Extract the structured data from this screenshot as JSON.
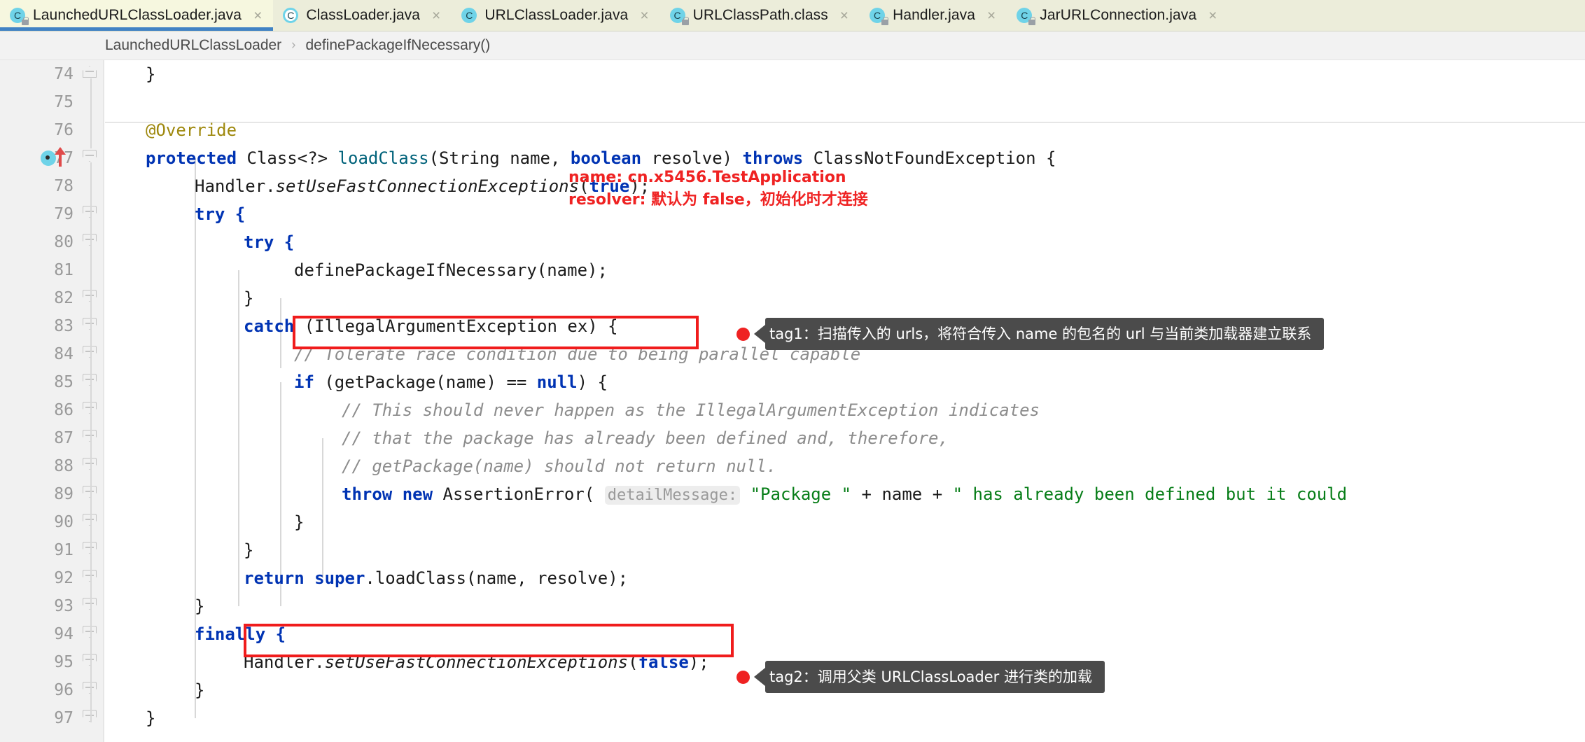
{
  "window": {
    "accent_blue": "#4183c4",
    "annotation_red": "#ef2222",
    "tooltip_gray": "#4b4b4b"
  },
  "tabs": [
    {
      "label": "LaunchedURLClassLoader.java",
      "icon": "java-class-icon",
      "locked": true,
      "active": true,
      "close": "×"
    },
    {
      "label": "ClassLoader.java",
      "icon": "java-class-icon",
      "locked": false,
      "active": false,
      "close": "×"
    },
    {
      "label": "URLClassLoader.java",
      "icon": "java-class-icon",
      "locked": false,
      "active": false,
      "close": "×"
    },
    {
      "label": "URLClassPath.class",
      "icon": "java-class-icon",
      "locked": true,
      "active": false,
      "close": "×"
    },
    {
      "label": "Handler.java",
      "icon": "java-class-icon",
      "locked": true,
      "active": false,
      "close": "×"
    },
    {
      "label": "JarURLConnection.java",
      "icon": "java-class-icon",
      "locked": true,
      "active": false,
      "close": "×"
    }
  ],
  "breadcrumb": {
    "class": "LaunchedURLClassLoader",
    "separator": "›",
    "method": "definePackageIfNecessary()"
  },
  "editor": {
    "first_line": 74,
    "gutter_icon": "method-overrides-icon",
    "gutter_icon_line": 77,
    "lines": [
      {
        "n": 74
      },
      {
        "n": 75
      },
      {
        "n": 76
      },
      {
        "n": 77
      },
      {
        "n": 78
      },
      {
        "n": 79
      },
      {
        "n": 80
      },
      {
        "n": 81
      },
      {
        "n": 82
      },
      {
        "n": 83
      },
      {
        "n": 84
      },
      {
        "n": 85
      },
      {
        "n": 86
      },
      {
        "n": 87
      },
      {
        "n": 88
      },
      {
        "n": 89
      },
      {
        "n": 90
      },
      {
        "n": 91
      },
      {
        "n": 92
      },
      {
        "n": 93
      },
      {
        "n": 94
      },
      {
        "n": 95
      },
      {
        "n": 96
      },
      {
        "n": 97
      }
    ],
    "parameter_hint": "detailMessage:"
  },
  "annotations": {
    "red_note_line1": "name: cn.x5456.TestApplication",
    "red_note_line2": "resolver: 默认为 false，初始化时才连接",
    "tag1": "tag1：扫描传入的 urls，将符合传入 name 的包名的 url 与当前类加载器建立联系",
    "tag2": "tag2：调用父类 URLClassLoader 进行类的加载",
    "highlight_1": "definePackageIfNecessary(name);",
    "highlight_2": "return super.loadClass(name, resolve);"
  },
  "code": {
    "l74": "}",
    "l75": "",
    "l76_annotation": "@Override",
    "l77_a": "protected",
    "l77_b": " Class<?> ",
    "l77_c": "loadClass",
    "l77_d": "(String name, ",
    "l77_e": "boolean",
    "l77_f": " resolve) ",
    "l77_g": "throws",
    "l77_h": " ClassNotFoundException {",
    "l78_a": "Handler.",
    "l78_b": "setUseFastConnectionExceptions",
    "l78_c": "(",
    "l78_d": "true",
    "l78_e": ");",
    "l79": "try {",
    "l80": "try {",
    "l81": "definePackageIfNecessary(name);",
    "l82": "}",
    "l83_a": "catch",
    "l83_b": " (IllegalArgumentException ex) {",
    "l84": "// Tolerate race condition due to being parallel capable",
    "l85_a": "if",
    "l85_b": " (getPackage(name) == ",
    "l85_c": "null",
    "l85_d": ") {",
    "l86": "// This should never happen as the IllegalArgumentException indicates",
    "l87": "// that the package has already been defined and, therefore,",
    "l88": "// getPackage(name) should not return null.",
    "l89_a": "throw",
    "l89_b": " ",
    "l89_c": "new",
    "l89_d": " AssertionError( ",
    "l89_hint": "detailMessage:",
    "l89_e": " ",
    "l89_f": "\"Package \"",
    "l89_g": " + name + ",
    "l89_h": "\" has already been defined but it could",
    "l90": "}",
    "l91": "}",
    "l92_a": "return",
    "l92_b": " ",
    "l92_c": "super",
    "l92_d": ".loadClass(name, resolve);",
    "l93": "}",
    "l94": "finally {",
    "l95_a": "Handler.",
    "l95_b": "setUseFastConnectionExceptions",
    "l95_c": "(",
    "l95_d": "false",
    "l95_e": ");",
    "l96": "}",
    "l97": "}"
  }
}
